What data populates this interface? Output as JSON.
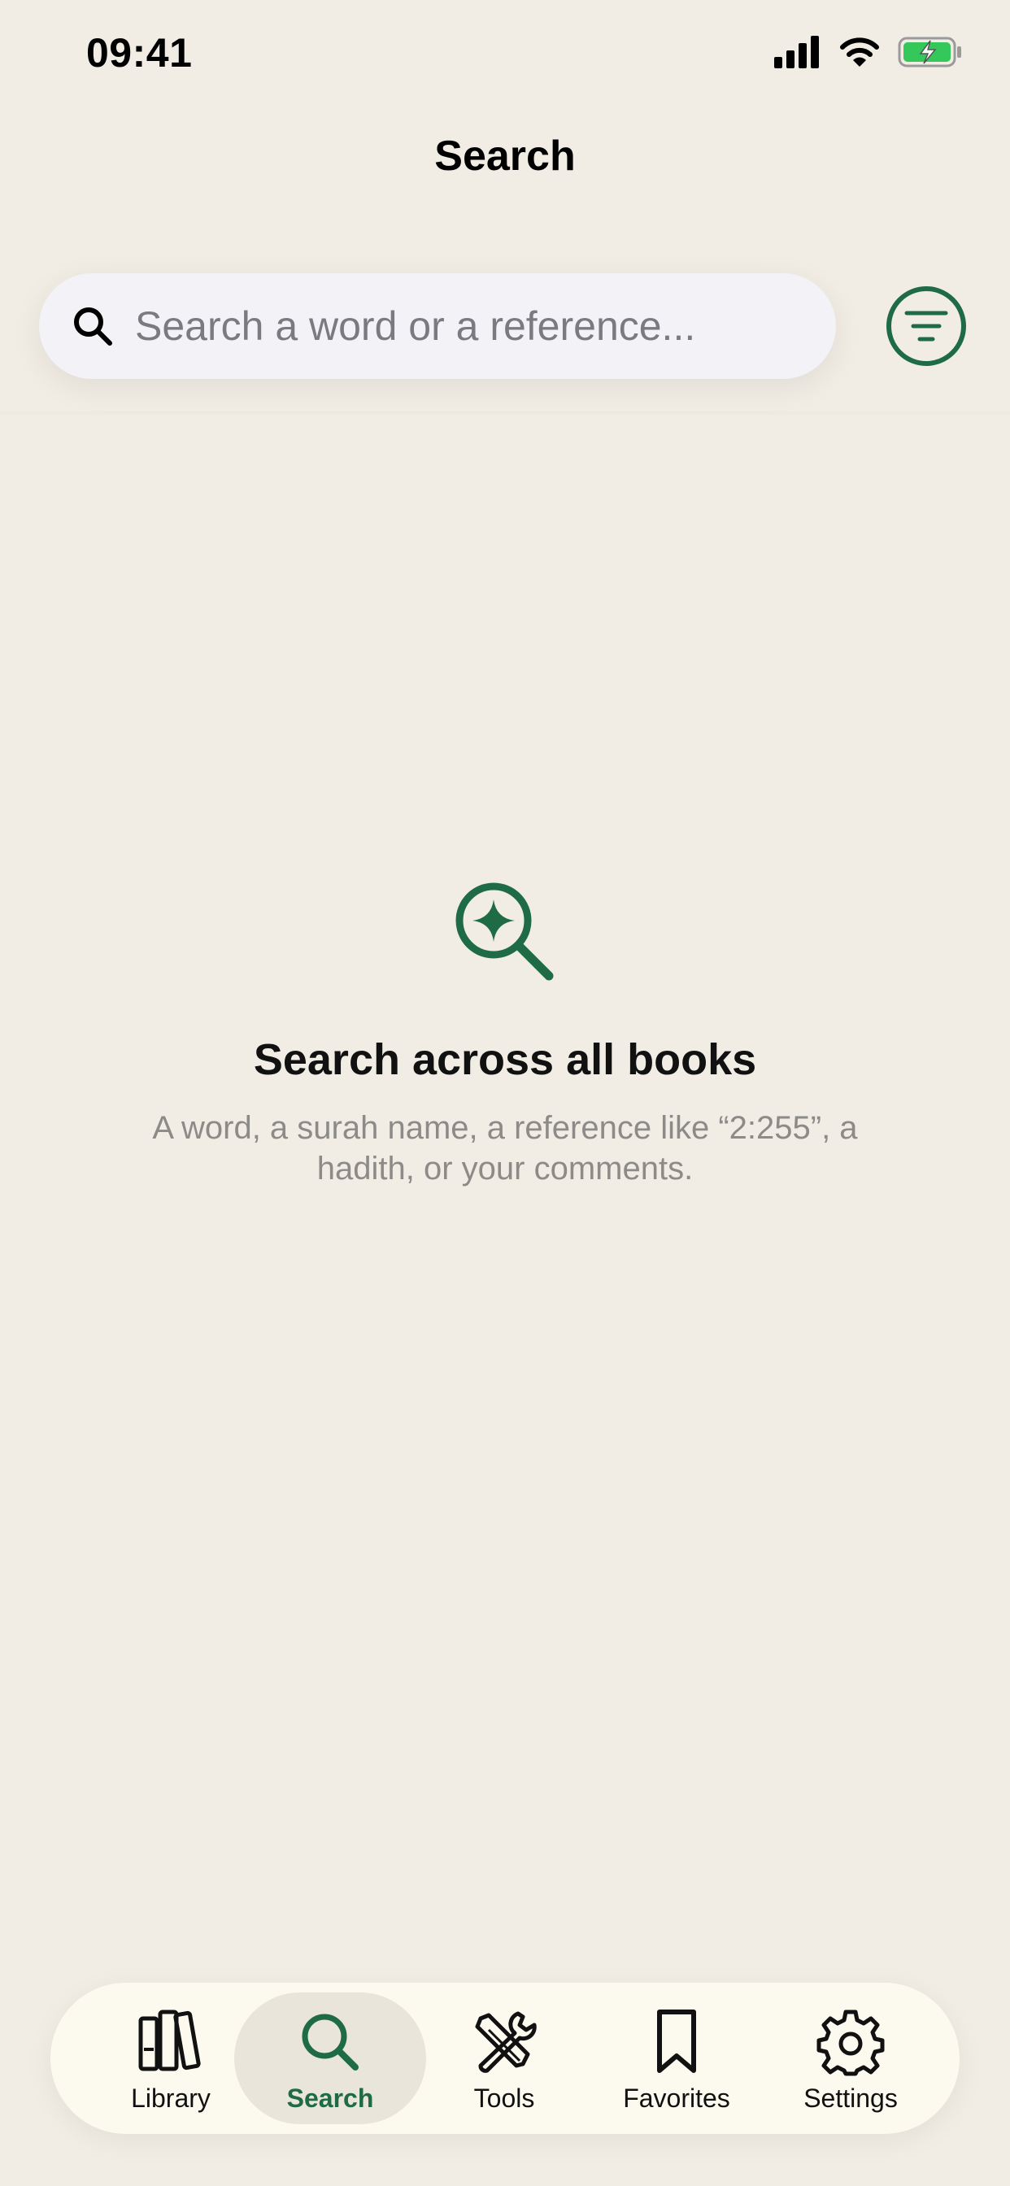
{
  "status": {
    "time": "09:41"
  },
  "nav": {
    "title": "Search"
  },
  "search": {
    "placeholder": "Search a word or a reference..."
  },
  "empty_state": {
    "title": "Search across all books",
    "subtitle": "A word, a surah name, a reference like “2:255”, a hadith, or your comments."
  },
  "tabs": [
    {
      "label": "Library",
      "icon": "books-icon",
      "active": false
    },
    {
      "label": "Search",
      "icon": "search-icon",
      "active": true
    },
    {
      "label": "Tools",
      "icon": "tools-icon",
      "active": false
    },
    {
      "label": "Favorites",
      "icon": "bookmark-icon",
      "active": false
    },
    {
      "label": "Settings",
      "icon": "gear-icon",
      "active": false
    }
  ],
  "colors": {
    "accent": "#1E6B45",
    "background": "#F1EDE5",
    "tab_bar": "#FCF9EE",
    "battery": "#34C759"
  }
}
